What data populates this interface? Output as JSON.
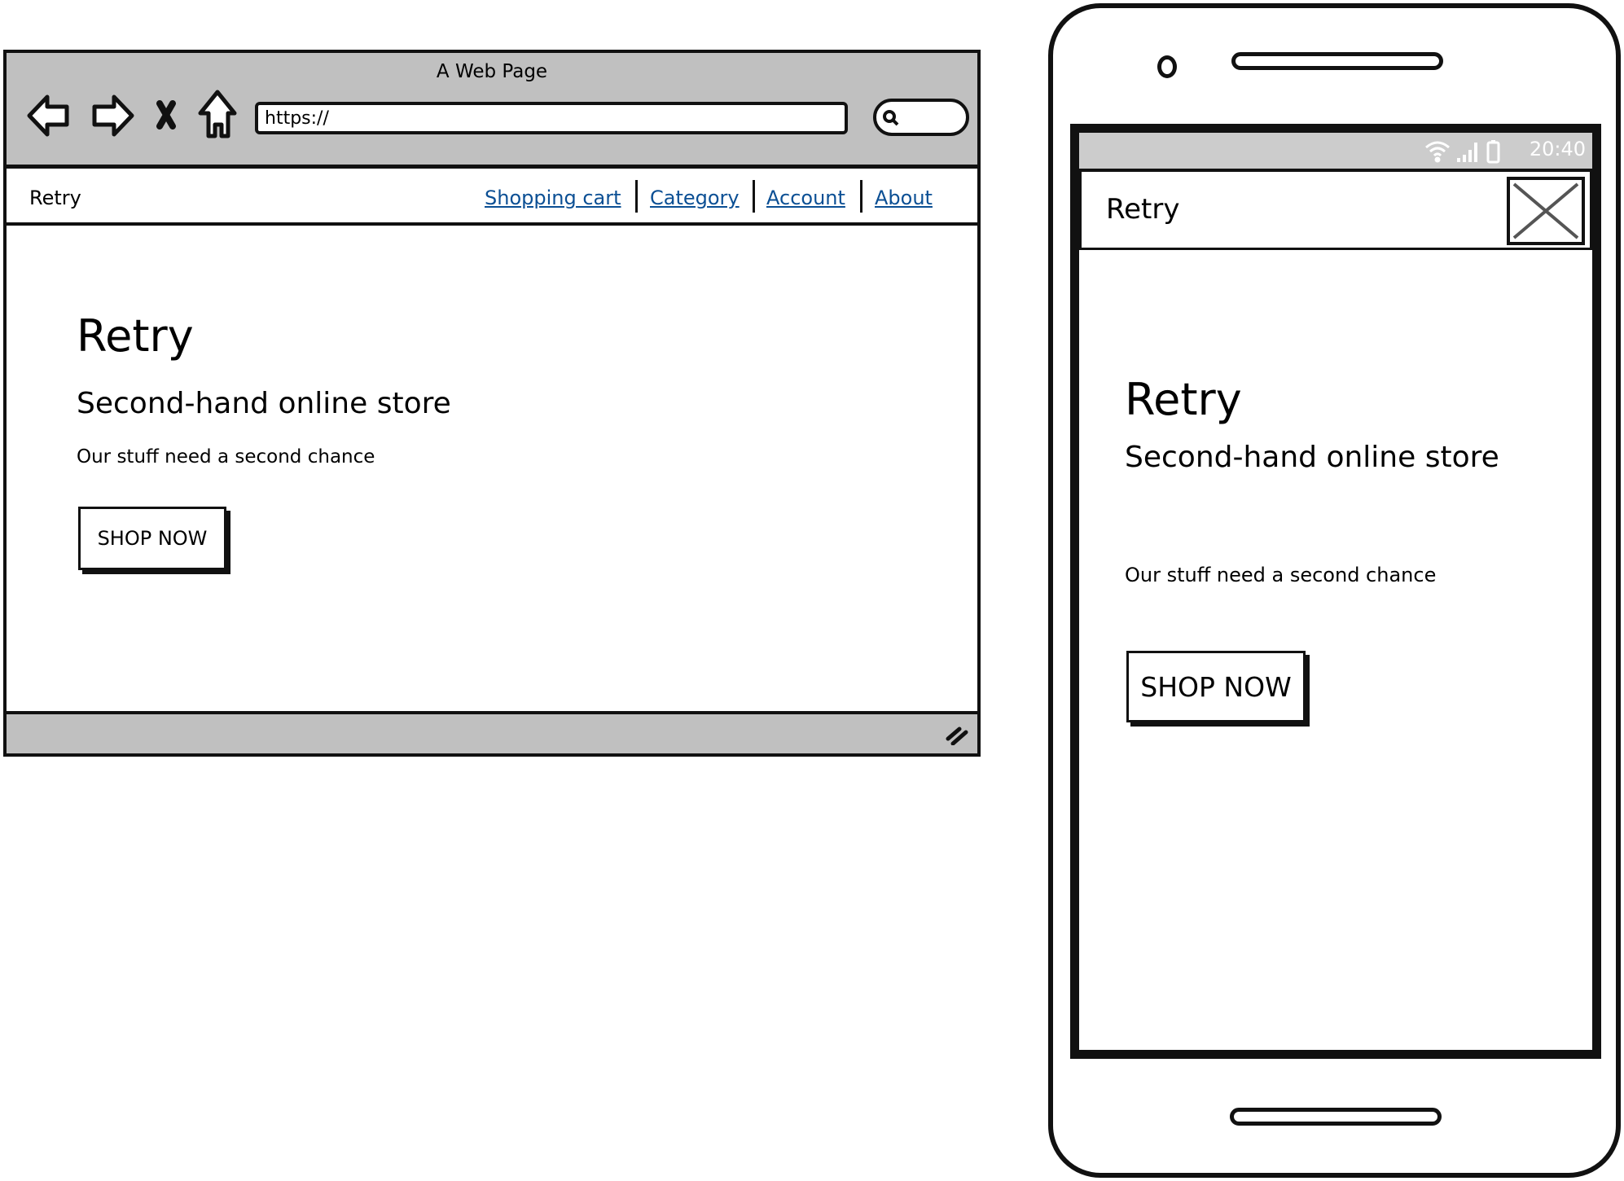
{
  "browser": {
    "window_title": "A Web Page",
    "url": "https://",
    "nav": {
      "brand": "Retry",
      "links": [
        {
          "label": "Shopping cart"
        },
        {
          "label": "Category"
        },
        {
          "label": "Account"
        },
        {
          "label": "About"
        }
      ],
      "link_color": "#0b4f94"
    },
    "hero": {
      "title": "Retry",
      "subtitle": "Second-hand online store",
      "tagline": "Our stuff need a second chance",
      "cta": "SHOP NOW"
    },
    "icons": [
      "back-arrow-icon",
      "forward-arrow-icon",
      "stop-icon",
      "home-icon",
      "search-icon",
      "resize-grip-icon"
    ]
  },
  "phone": {
    "status_bar": {
      "time": "20:40",
      "icons": [
        "wifi-icon",
        "signal-icon",
        "battery-icon"
      ]
    },
    "app_bar": {
      "title": "Retry",
      "image_placeholder": "image-placeholder-icon"
    },
    "hero": {
      "title": "Retry",
      "subtitle": "Second-hand online store",
      "tagline": "Our stuff need a second chance",
      "cta": "SHOP NOW"
    }
  }
}
